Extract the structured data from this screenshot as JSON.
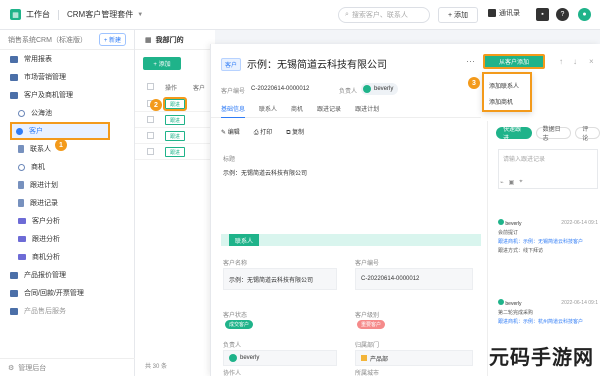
{
  "topbar": {
    "workspace": "工作台",
    "app_name": "CRM客户管理套件",
    "search_placeholder": "搜索客户、联系人",
    "add_label": "+ 添加",
    "contacts_label": "通讯录"
  },
  "sidebar": {
    "header": "销售系统CRM（标准版）",
    "new_button": "+ 新建",
    "items": [
      {
        "label": "常用报表"
      },
      {
        "label": "市场营销管理"
      },
      {
        "label": "客户及商机管理"
      },
      {
        "label": "公海池"
      },
      {
        "label": "客户"
      },
      {
        "label": "联系人"
      },
      {
        "label": "商机"
      },
      {
        "label": "跟进计划"
      },
      {
        "label": "跟进记录"
      },
      {
        "label": "客户分析"
      },
      {
        "label": "跟进分析"
      },
      {
        "label": "商机分析"
      },
      {
        "label": "产品报价管理"
      },
      {
        "label": "合同/回款/开票管理"
      },
      {
        "label": "产品售后服务"
      }
    ],
    "footer": "管理后台"
  },
  "list": {
    "title": "我部门的",
    "add_button": "+ 添加",
    "col_action": "操作",
    "col_customer": "客户",
    "follow_label": "跟进",
    "footer": "共 30 条"
  },
  "detail": {
    "tag": "客户",
    "title": "示例：无锡简道云科技有限公司",
    "more": "···",
    "action_button": "从客户添加",
    "customer_no_label": "客户编号",
    "customer_no": "C-20220614-0000012",
    "owner_label": "负责人",
    "owner_name": "beverly",
    "tabs": [
      "基础信息",
      "联系人",
      "商机",
      "跟进记录",
      "跟进计划"
    ],
    "tools": [
      "编辑",
      "打印",
      "复制"
    ],
    "title_label": "标题",
    "title_value": "示例：无锡简道云科技有限公司",
    "section_name": "联系人",
    "f_name_label": "客户名称",
    "f_name_value": "示例：无锡简道云科技有限公司",
    "f_no_label": "客户编号",
    "f_no_value": "C-20220614-0000012",
    "f_status_label": "客户状态",
    "f_status_value": "成交客户",
    "f_level_label": "客户级别",
    "f_level_value": "重要客户",
    "f_owner_label": "负责人",
    "f_owner_value": "beverly",
    "f_dept_label": "归属部门",
    "f_dept_value": "产品部",
    "f_helper_label": "协作人",
    "f_city_label": "所属城市",
    "f_city_value": "示例：杭州公海池"
  },
  "menu": {
    "items": [
      "添加联系人",
      "添加商机"
    ]
  },
  "right": {
    "tabs": [
      "快速跟进",
      "数据日志",
      "评论"
    ],
    "input_placeholder": "请输入跟进记录",
    "cards": [
      {
        "name": "beverly",
        "time": "2022-06-14 09:1",
        "l1": "会前提订",
        "l2": "跟进商机：示例：无锡简道云科技客户",
        "l3": "跟进方式：线下拜访"
      },
      {
        "name": "beverly",
        "time": "2022-06-14 09:1",
        "l1": "第二轮完成采购",
        "l2": "跟进商机：示例：杭州简道云科技客户",
        "l3": ""
      }
    ]
  },
  "badges": {
    "b1": "1",
    "b2": "2",
    "b3": "3"
  },
  "watermark": "元码手游网",
  "colors": {
    "accent": "#1fb38a",
    "link": "#2f7cf6",
    "highlight": "#f39a1b"
  }
}
